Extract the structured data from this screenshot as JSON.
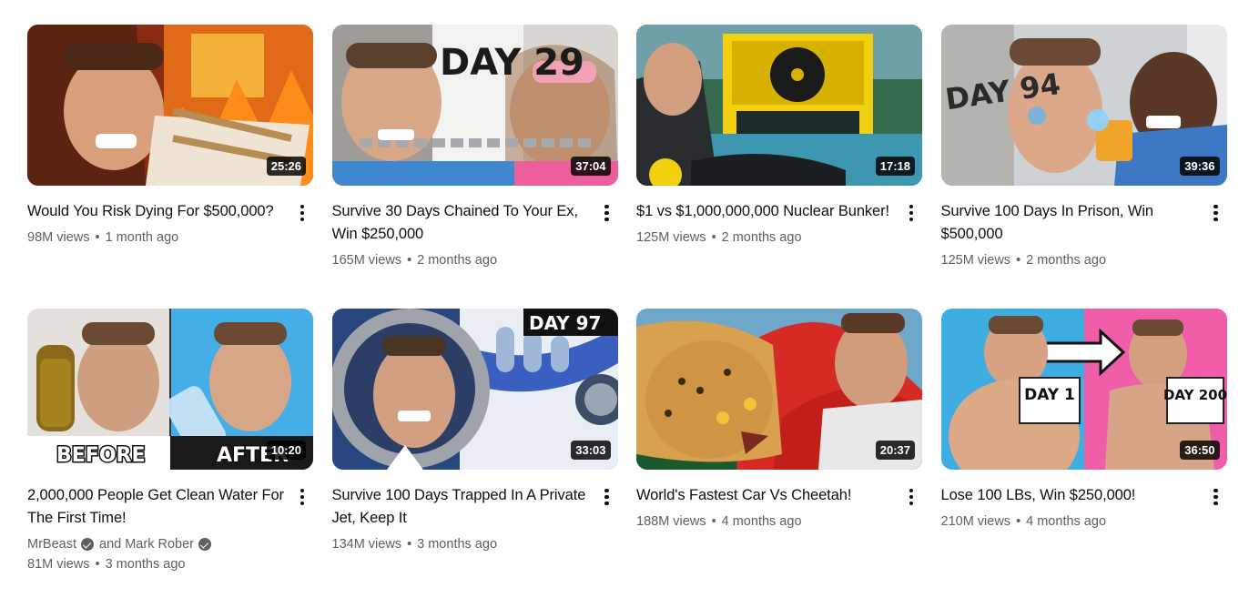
{
  "videos": [
    {
      "title": "Would You Risk Dying For $500,000?",
      "duration": "25:26",
      "views": "98M views",
      "age": "1 month ago"
    },
    {
      "title": "Survive 30 Days Chained To Your Ex, Win $250,000",
      "duration": "37:04",
      "views": "165M views",
      "age": "2 months ago",
      "thumb_text": "DAY 29"
    },
    {
      "title": "$1 vs $1,000,000,000 Nuclear Bunker!",
      "duration": "17:18",
      "views": "125M views",
      "age": "2 months ago"
    },
    {
      "title": "Survive 100 Days In Prison, Win $500,000",
      "duration": "39:36",
      "views": "125M views",
      "age": "2 months ago",
      "thumb_text": "DAY 94"
    },
    {
      "title": "2,000,000 People Get Clean Water For The First Time!",
      "duration": "10:20",
      "channel_primary": "MrBeast",
      "channel_secondary": "and Mark Rober",
      "views": "81M views",
      "age": "3 months ago",
      "thumb_text_left": "BEFORE",
      "thumb_text_right": "AFTER"
    },
    {
      "title": "Survive 100 Days Trapped In A Private Jet, Keep It",
      "duration": "33:03",
      "views": "134M views",
      "age": "3 months ago",
      "thumb_text": "DAY 97"
    },
    {
      "title": "World's Fastest Car Vs Cheetah!",
      "duration": "20:37",
      "views": "188M views",
      "age": "4 months ago"
    },
    {
      "title": "Lose 100 LBs, Win $250,000!",
      "duration": "36:50",
      "views": "210M views",
      "age": "4 months ago",
      "thumb_text_left": "DAY 1",
      "thumb_text_right": "DAY 200"
    }
  ],
  "separator": "•"
}
